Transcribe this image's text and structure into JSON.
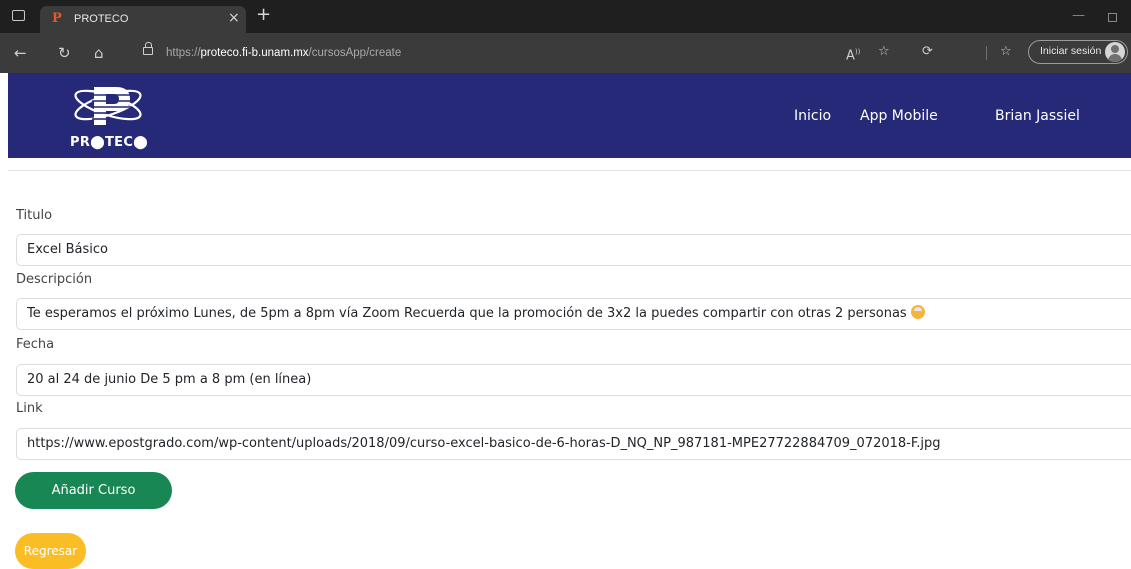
{
  "browser": {
    "tab_title": "PROTECO",
    "favicon_letter": "P",
    "tab_close": "×",
    "new_tab": "+",
    "url_scheme": "https://",
    "url_host": "proteco.fi-b.unam.mx",
    "url_path": "/cursosApp/create",
    "signin_label": "Iniciar sesión"
  },
  "site": {
    "logo_text": "PR⬤TEC⬤",
    "nav": {
      "inicio": "Inicio",
      "app_mobile": "App Mobile",
      "user": "Brian Jassiel"
    }
  },
  "form": {
    "titulo_label": "Titulo",
    "titulo_value": "Excel Básico",
    "descripcion_label": "Descripción",
    "descripcion_value": "Te esperamos el próximo Lunes, de 5pm a 8pm vía Zoom Recuerda que la promoción de 3x2 la puedes compartir con otras 2 personas",
    "fecha_label": "Fecha",
    "fecha_value": "20 al 24 de junio De 5 pm a 8 pm (en línea)",
    "link_label": "Link",
    "link_value": "https://www.epostgrado.com/wp-content/uploads/2018/09/curso-excel-basico-de-6-horas-D_NQ_NP_987181-MPE27722884709_072018-F.jpg",
    "add_button": "Añadir Curso",
    "back_button": "Regresar"
  },
  "colors": {
    "nav_bg": "#262878",
    "add_button": "#198754",
    "back_button": "#fbbd24"
  }
}
